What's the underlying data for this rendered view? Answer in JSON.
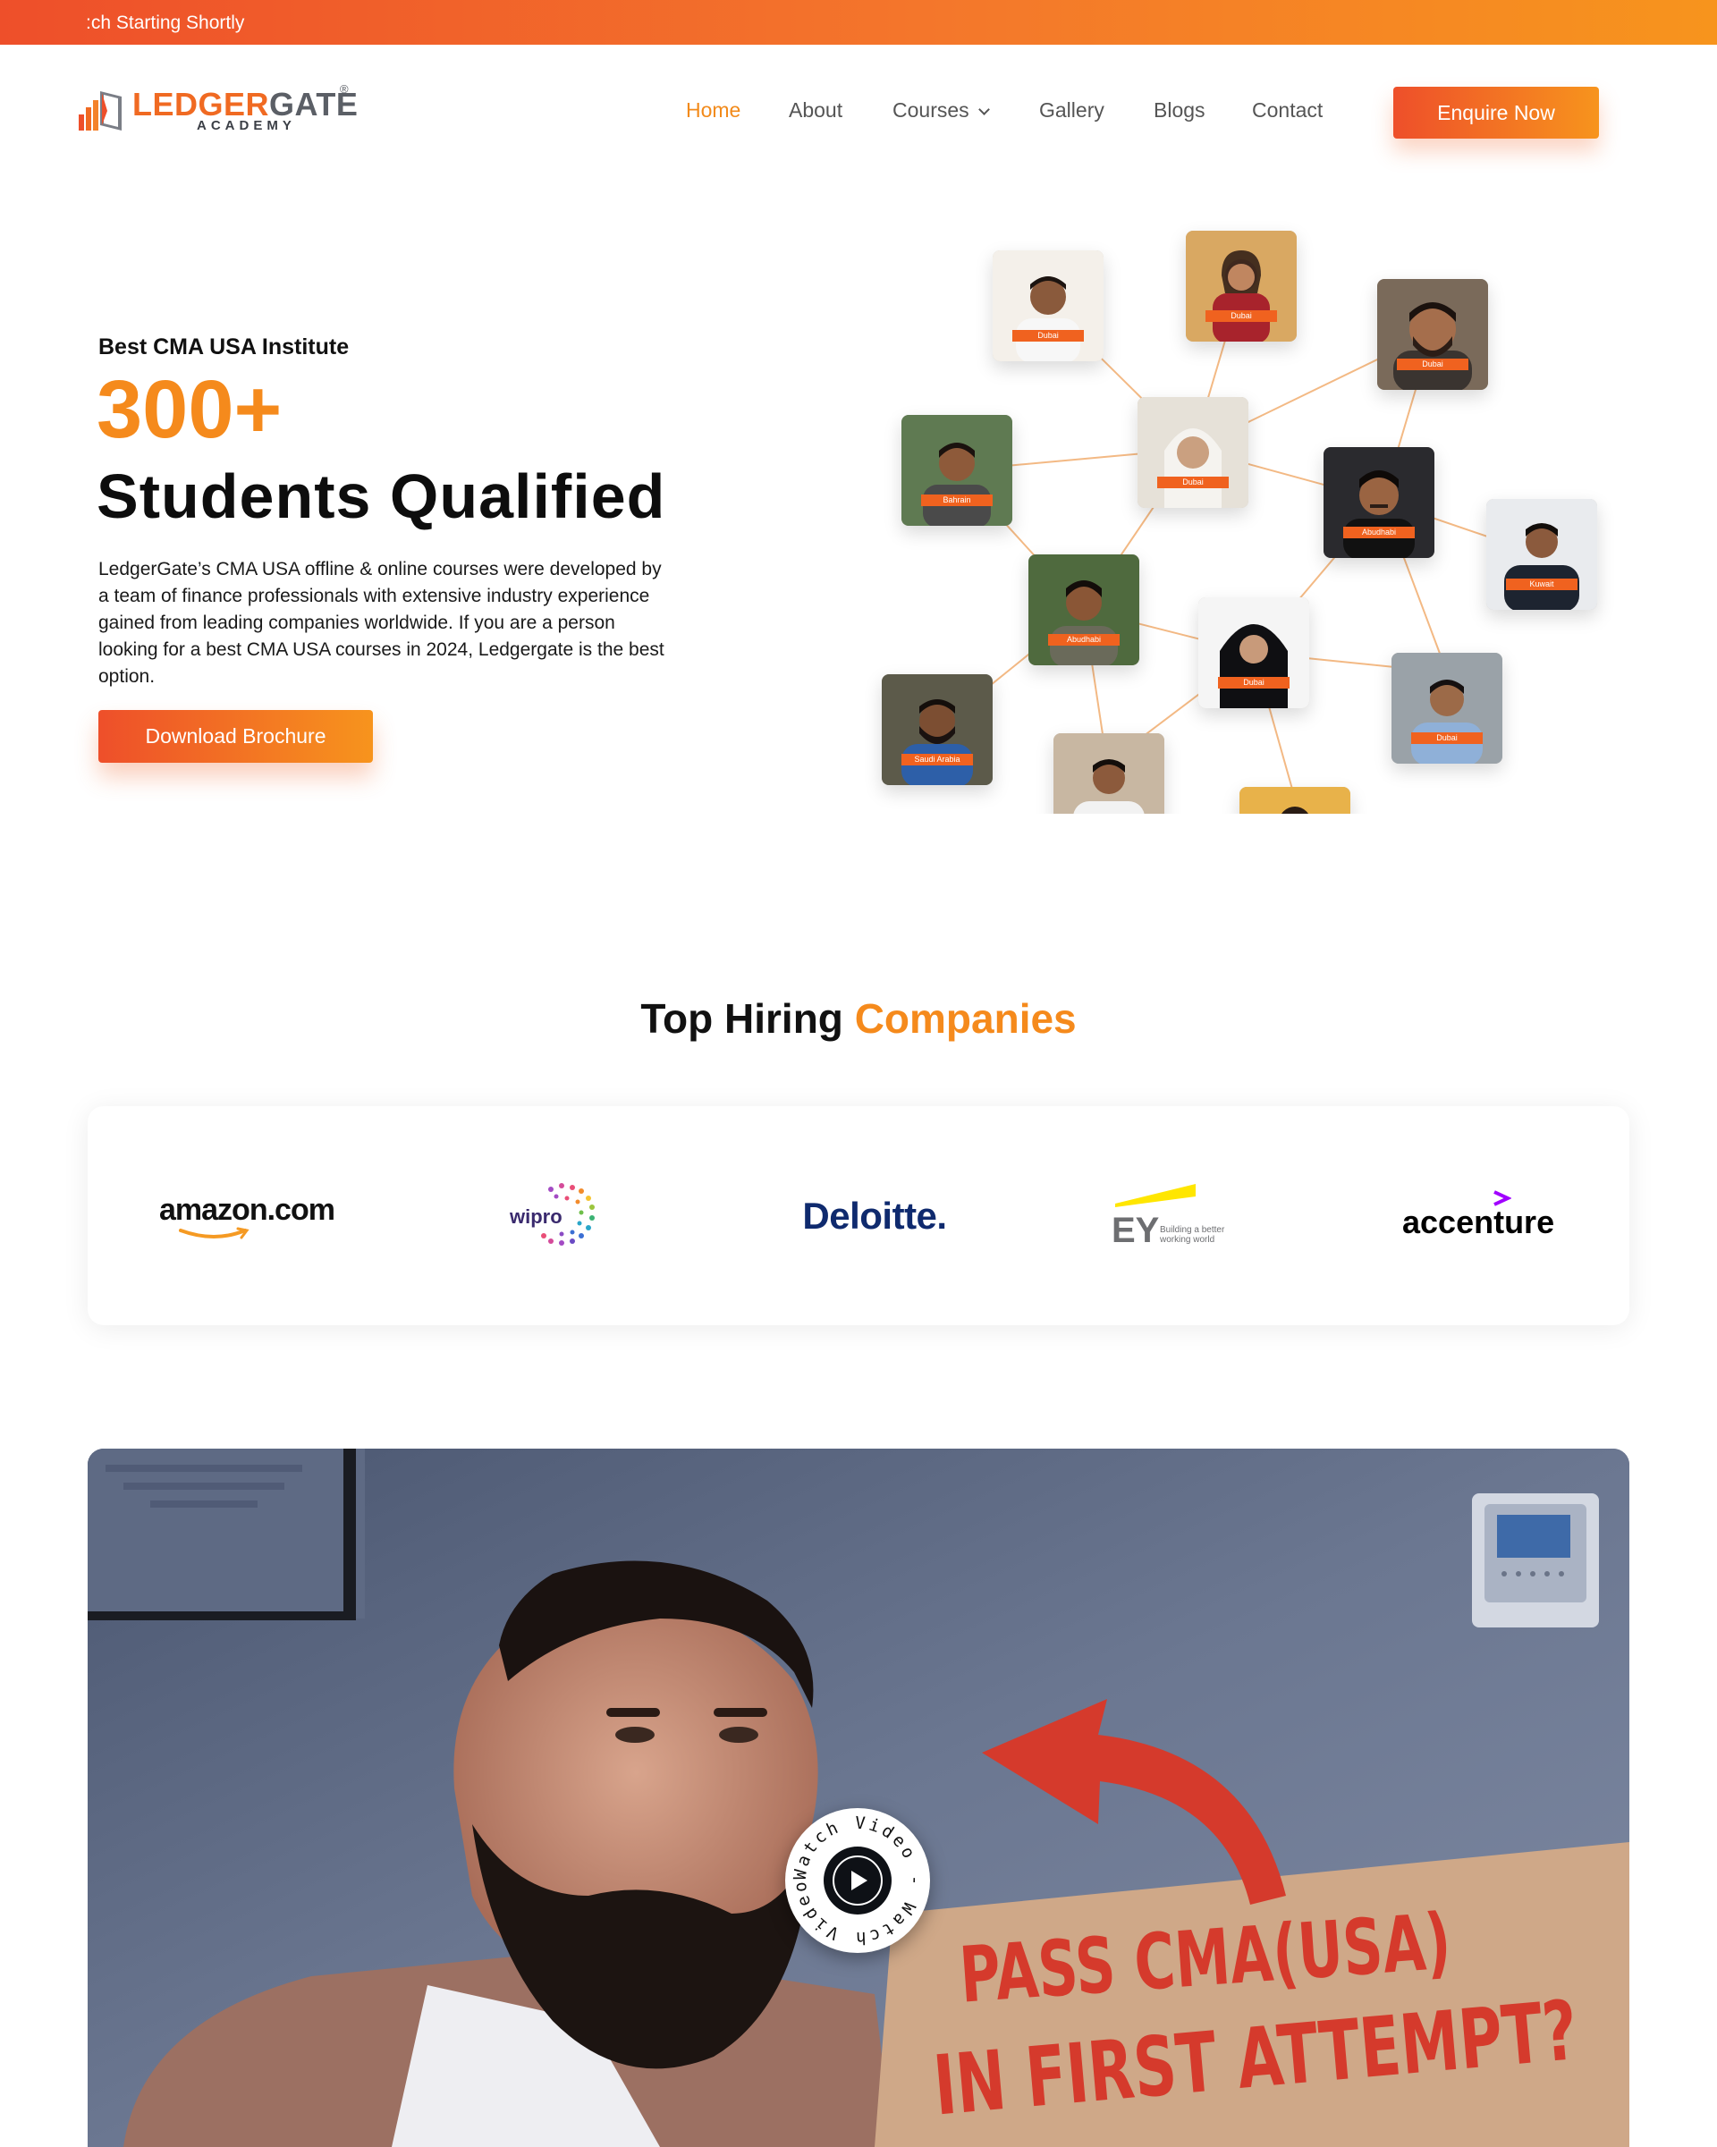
{
  "topbar": {
    "text": ":ch Starting Shortly"
  },
  "logo": {
    "word_a": "LEDGER",
    "word_b": "GATE",
    "reg": "®",
    "sub": "ACADEMY"
  },
  "nav": {
    "items": [
      {
        "label": "Home",
        "active": true
      },
      {
        "label": "About"
      },
      {
        "label": "Courses",
        "has_dropdown": true
      },
      {
        "label": "Gallery"
      },
      {
        "label": "Blogs"
      },
      {
        "label": "Contact"
      }
    ],
    "cta": "Enquire Now"
  },
  "hero": {
    "eyebrow": "Best CMA USA Institute",
    "number": "300+",
    "title": "Students Qualified",
    "description": "LedgerGate’s CMA USA offline & online courses were developed by a team of finance professionals with extensive industry experience gained from leading companies worldwide. If you are a person looking for a best CMA USA courses in 2024, Ledgergate is the best option.",
    "cta": "Download Brochure",
    "students": [
      {
        "tag": "Dubai"
      },
      {
        "tag": "Dubai"
      },
      {
        "tag": "Dubai"
      },
      {
        "tag": "Dubai"
      },
      {
        "tag": "Bahrain"
      },
      {
        "tag": "Abudhabi"
      },
      {
        "tag": "Kuwait"
      },
      {
        "tag": "Abudhabi"
      },
      {
        "tag": "Dubai"
      },
      {
        "tag": "Dubai"
      },
      {
        "tag": "Saudi Arabia"
      },
      {
        "tag": ""
      },
      {
        "tag": ""
      }
    ]
  },
  "hiring": {
    "title_a": "Top Hiring",
    "title_b": "Companies",
    "companies": [
      {
        "name": "amazon.com",
        "icon": "amazon-logo"
      },
      {
        "name": "wipro",
        "icon": "wipro-logo"
      },
      {
        "name": "Deloitte.",
        "icon": "deloitte-logo"
      },
      {
        "name": "EY",
        "tagline": "Building a better working world",
        "icon": "ey-logo"
      },
      {
        "name": "accenture",
        "icon": "accenture-logo"
      }
    ]
  },
  "video": {
    "badge_text": "Watch Video - Watch Video - ",
    "sign_line1": "PASS CMA(USA)",
    "sign_line2": "IN FIRST ATTEMPT?",
    "icon": "play-icon"
  },
  "colors": {
    "accent": "#f58a1c",
    "accent_red": "#ee4f2a",
    "text": "#111111"
  }
}
